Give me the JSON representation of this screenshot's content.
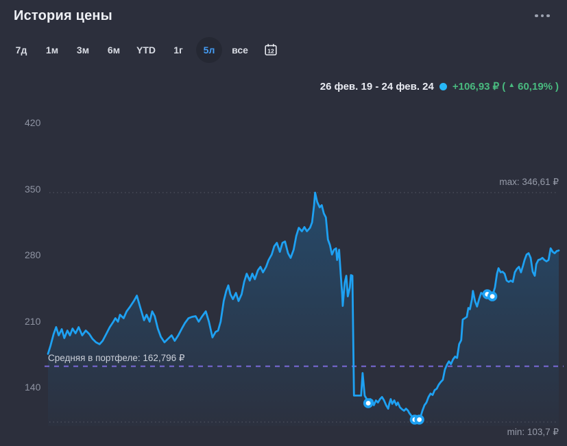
{
  "header": {
    "title": "История цены"
  },
  "icons": {
    "up_triangle": "▲"
  },
  "tabs": {
    "items": [
      {
        "id": "7d",
        "label": "7д"
      },
      {
        "id": "1m",
        "label": "1м"
      },
      {
        "id": "3m",
        "label": "3м"
      },
      {
        "id": "6m",
        "label": "6м"
      },
      {
        "id": "ytd",
        "label": "YTD"
      },
      {
        "id": "1y",
        "label": "1г"
      },
      {
        "id": "5y",
        "label": "5л"
      },
      {
        "id": "all",
        "label": "все"
      }
    ],
    "selected": "5л",
    "calendar_day": "12"
  },
  "stats": {
    "date_range": "26 фев. 19 - 24 фев. 24",
    "change_value": "+106,93 ₽",
    "paren_open": "(",
    "change_percent": "60,19%",
    "paren_close": ")"
  },
  "chart_data": {
    "type": "line",
    "title": "История цены",
    "period_selected": "5л",
    "x_range": [
      "26 фев. 19",
      "24 фев. 24"
    ],
    "y_ticks": [
      420,
      350,
      280,
      210,
      140
    ],
    "y_unit": "₽",
    "grid": "max/min dotted, average dashed",
    "legend_position": "none",
    "max": {
      "label": "max: 346,61 ₽",
      "value": 346.61
    },
    "min": {
      "label": "min: 103,7 ₽",
      "value": 103.7
    },
    "average": {
      "label": "Средняя в портфеле: 162,796 ₽",
      "value": 162.796
    },
    "change": {
      "value_rub": 106.93,
      "percent": 60.19
    },
    "colors": {
      "background": "#2c2f3c",
      "line": "#1ea1f2",
      "fill": "#1786d2",
      "average_line": "#7a6ad8",
      "grid_dotted": "#555966",
      "gain_green": "#49ba7f",
      "header_dot": "#27b7f7",
      "tab_accent": "#459df5"
    },
    "series": [
      {
        "name": "price",
        "points": [
          [
            0.0,
            175.9
          ],
          [
            0.005,
            184.6
          ],
          [
            0.011,
            196.9
          ],
          [
            0.016,
            204.2
          ],
          [
            0.021,
            195.5
          ],
          [
            0.027,
            202.0
          ],
          [
            0.032,
            192.6
          ],
          [
            0.038,
            200.6
          ],
          [
            0.043,
            195.5
          ],
          [
            0.048,
            202.7
          ],
          [
            0.054,
            197.7
          ],
          [
            0.06,
            204.2
          ],
          [
            0.067,
            195.5
          ],
          [
            0.074,
            200.6
          ],
          [
            0.081,
            196.9
          ],
          [
            0.087,
            191.9
          ],
          [
            0.094,
            188.2
          ],
          [
            0.101,
            186.1
          ],
          [
            0.107,
            189.7
          ],
          [
            0.114,
            196.9
          ],
          [
            0.121,
            204.2
          ],
          [
            0.128,
            210.0
          ],
          [
            0.132,
            213.6
          ],
          [
            0.137,
            210.0
          ],
          [
            0.141,
            217.3
          ],
          [
            0.148,
            213.6
          ],
          [
            0.154,
            220.9
          ],
          [
            0.161,
            226.0
          ],
          [
            0.168,
            231.8
          ],
          [
            0.174,
            237.6
          ],
          [
            0.181,
            224.5
          ],
          [
            0.188,
            211.5
          ],
          [
            0.193,
            217.3
          ],
          [
            0.199,
            210.0
          ],
          [
            0.204,
            220.9
          ],
          [
            0.209,
            215.8
          ],
          [
            0.215,
            202.7
          ],
          [
            0.221,
            194.0
          ],
          [
            0.228,
            188.2
          ],
          [
            0.235,
            191.9
          ],
          [
            0.242,
            195.5
          ],
          [
            0.248,
            189.7
          ],
          [
            0.255,
            195.5
          ],
          [
            0.262,
            202.7
          ],
          [
            0.268,
            208.5
          ],
          [
            0.275,
            213.6
          ],
          [
            0.282,
            215.1
          ],
          [
            0.289,
            215.8
          ],
          [
            0.295,
            210.0
          ],
          [
            0.302,
            215.8
          ],
          [
            0.309,
            220.9
          ],
          [
            0.315,
            210.0
          ],
          [
            0.322,
            193.3
          ],
          [
            0.328,
            199.1
          ],
          [
            0.333,
            200.6
          ],
          [
            0.338,
            210.0
          ],
          [
            0.344,
            231.8
          ],
          [
            0.349,
            242.6
          ],
          [
            0.353,
            248.4
          ],
          [
            0.357,
            239.0
          ],
          [
            0.362,
            233.9
          ],
          [
            0.368,
            240.5
          ],
          [
            0.373,
            231.8
          ],
          [
            0.379,
            239.0
          ],
          [
            0.384,
            252.1
          ],
          [
            0.389,
            260.8
          ],
          [
            0.395,
            253.5
          ],
          [
            0.4,
            260.8
          ],
          [
            0.405,
            255.0
          ],
          [
            0.411,
            264.4
          ],
          [
            0.416,
            268.0
          ],
          [
            0.421,
            262.2
          ],
          [
            0.427,
            268.0
          ],
          [
            0.432,
            275.3
          ],
          [
            0.438,
            281.1
          ],
          [
            0.443,
            289.8
          ],
          [
            0.448,
            293.4
          ],
          [
            0.454,
            284.0
          ],
          [
            0.459,
            293.4
          ],
          [
            0.464,
            294.9
          ],
          [
            0.47,
            282.5
          ],
          [
            0.475,
            277.5
          ],
          [
            0.481,
            286.2
          ],
          [
            0.486,
            300.7
          ],
          [
            0.491,
            309.4
          ],
          [
            0.497,
            305.7
          ],
          [
            0.502,
            310.1
          ],
          [
            0.507,
            305.7
          ],
          [
            0.513,
            309.4
          ],
          [
            0.517,
            315.2
          ],
          [
            0.521,
            333.3
          ],
          [
            0.523,
            346.6
          ],
          [
            0.527,
            336.9
          ],
          [
            0.532,
            331.1
          ],
          [
            0.536,
            333.3
          ],
          [
            0.54,
            324.6
          ],
          [
            0.544,
            320.3
          ],
          [
            0.548,
            297.0
          ],
          [
            0.552,
            291.2
          ],
          [
            0.556,
            281.1
          ],
          [
            0.56,
            286.2
          ],
          [
            0.564,
            287.6
          ],
          [
            0.566,
            275.3
          ],
          [
            0.57,
            286.2
          ],
          [
            0.573,
            260.8
          ],
          [
            0.576,
            239.0
          ],
          [
            0.577,
            226.7
          ],
          [
            0.581,
            251.3
          ],
          [
            0.584,
            258.6
          ],
          [
            0.587,
            236.8
          ],
          [
            0.591,
            246.3
          ],
          [
            0.593,
            259.3
          ],
          [
            0.596,
            258.6
          ],
          [
            0.599,
            131.7
          ],
          [
            0.613,
            131.7
          ],
          [
            0.616,
            155.6
          ],
          [
            0.62,
            131.7
          ],
          [
            0.624,
            128.0
          ],
          [
            0.627,
            123.7
          ],
          [
            0.631,
            128.0
          ],
          [
            0.635,
            126.6
          ],
          [
            0.638,
            121.5
          ],
          [
            0.642,
            126.6
          ],
          [
            0.646,
            124.4
          ],
          [
            0.65,
            128.0
          ],
          [
            0.654,
            130.2
          ],
          [
            0.658,
            126.6
          ],
          [
            0.662,
            121.5
          ],
          [
            0.666,
            117.9
          ],
          [
            0.668,
            123.0
          ],
          [
            0.671,
            128.0
          ],
          [
            0.674,
            123.0
          ],
          [
            0.678,
            126.6
          ],
          [
            0.682,
            121.5
          ],
          [
            0.685,
            124.4
          ],
          [
            0.689,
            119.3
          ],
          [
            0.693,
            117.2
          ],
          [
            0.697,
            115.7
          ],
          [
            0.701,
            117.9
          ],
          [
            0.705,
            115.7
          ],
          [
            0.707,
            113.5
          ],
          [
            0.711,
            110.6
          ],
          [
            0.715,
            107.7
          ],
          [
            0.718,
            106.3
          ],
          [
            0.721,
            103.7
          ],
          [
            0.727,
            106.3
          ],
          [
            0.729,
            108.4
          ],
          [
            0.733,
            115.7
          ],
          [
            0.737,
            121.5
          ],
          [
            0.741,
            124.4
          ],
          [
            0.745,
            130.2
          ],
          [
            0.749,
            133.8
          ],
          [
            0.753,
            132.4
          ],
          [
            0.757,
            137.5
          ],
          [
            0.761,
            138.9
          ],
          [
            0.765,
            143.3
          ],
          [
            0.769,
            146.2
          ],
          [
            0.773,
            148.4
          ],
          [
            0.777,
            159.2
          ],
          [
            0.781,
            164.3
          ],
          [
            0.785,
            167.9
          ],
          [
            0.789,
            165.0
          ],
          [
            0.793,
            170.1
          ],
          [
            0.797,
            173.0
          ],
          [
            0.801,
            171.6
          ],
          [
            0.805,
            186.1
          ],
          [
            0.809,
            190.4
          ],
          [
            0.812,
            212.2
          ],
          [
            0.816,
            213.6
          ],
          [
            0.82,
            215.1
          ],
          [
            0.823,
            224.5
          ],
          [
            0.826,
            223.1
          ],
          [
            0.83,
            233.9
          ],
          [
            0.832,
            242.6
          ],
          [
            0.836,
            231.8
          ],
          [
            0.84,
            226.0
          ],
          [
            0.844,
            233.9
          ],
          [
            0.848,
            240.5
          ],
          [
            0.852,
            239.0
          ],
          [
            0.856,
            240.5
          ],
          [
            0.86,
            239.0
          ],
          [
            0.864,
            237.6
          ],
          [
            0.87,
            236.8
          ],
          [
            0.875,
            246.3
          ],
          [
            0.879,
            260.8
          ],
          [
            0.882,
            266.6
          ],
          [
            0.886,
            262.2
          ],
          [
            0.89,
            262.9
          ],
          [
            0.894,
            260.8
          ],
          [
            0.898,
            253.5
          ],
          [
            0.902,
            252.1
          ],
          [
            0.906,
            253.5
          ],
          [
            0.91,
            252.1
          ],
          [
            0.914,
            262.2
          ],
          [
            0.918,
            265.9
          ],
          [
            0.922,
            268.0
          ],
          [
            0.926,
            262.2
          ],
          [
            0.93,
            269.5
          ],
          [
            0.933,
            275.3
          ],
          [
            0.937,
            281.1
          ],
          [
            0.941,
            282.5
          ],
          [
            0.945,
            277.5
          ],
          [
            0.949,
            262.9
          ],
          [
            0.953,
            258.6
          ],
          [
            0.956,
            270.9
          ],
          [
            0.96,
            275.3
          ],
          [
            0.964,
            276.0
          ],
          [
            0.968,
            277.5
          ],
          [
            0.972,
            275.3
          ],
          [
            0.976,
            273.8
          ],
          [
            0.98,
            275.3
          ],
          [
            0.984,
            287.6
          ],
          [
            0.988,
            284.0
          ],
          [
            0.992,
            282.5
          ],
          [
            0.996,
            284.7
          ],
          [
            1.0,
            285.4
          ]
        ]
      }
    ],
    "markers": [
      [
        0.627,
        123.7
      ],
      [
        0.718,
        106.3
      ],
      [
        0.727,
        106.3
      ],
      [
        0.86,
        239.0
      ],
      [
        0.87,
        236.8
      ]
    ]
  }
}
